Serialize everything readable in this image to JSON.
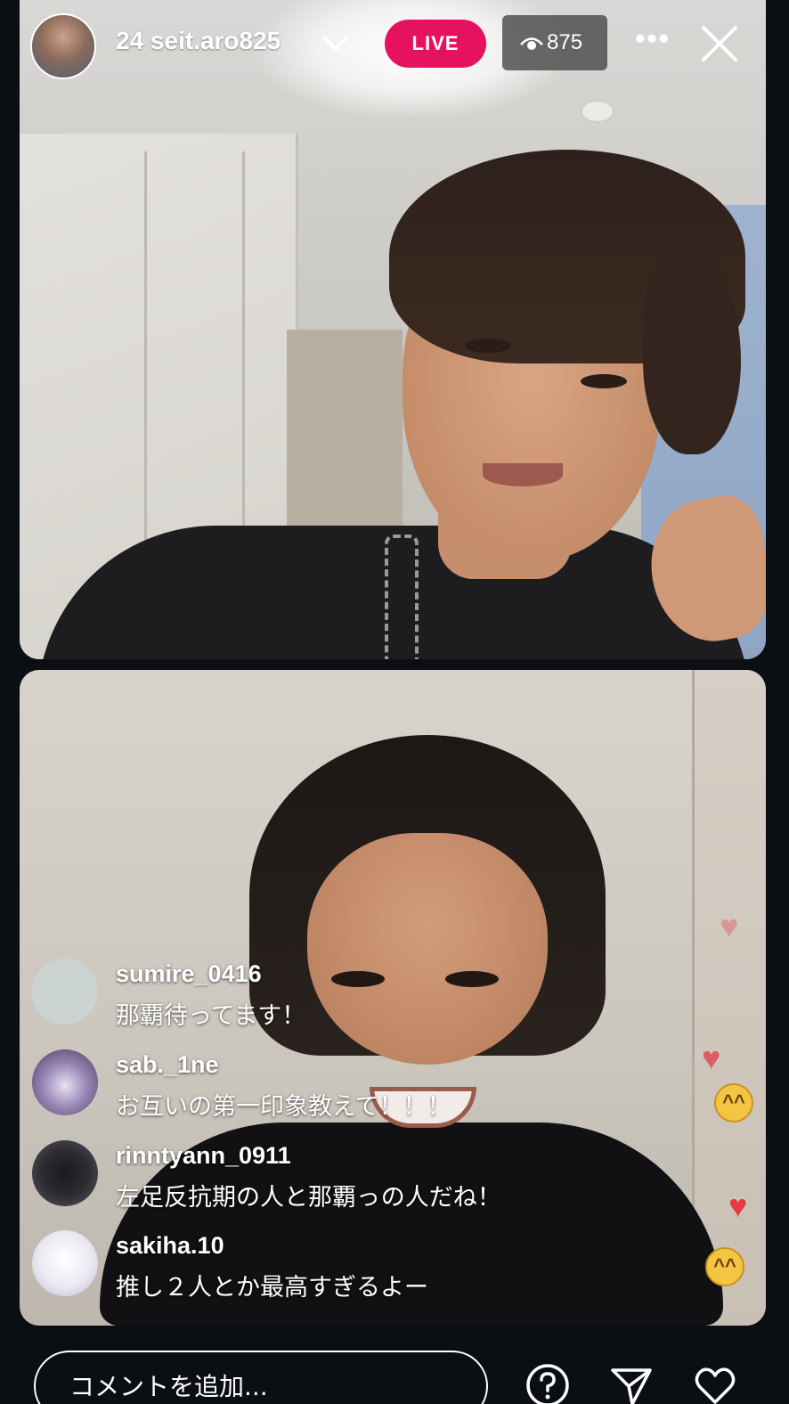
{
  "header": {
    "username": "24  seit.aro825",
    "live_label": "LIVE",
    "viewer_count": "875",
    "more_label": "•••"
  },
  "comments": [
    {
      "user": "sumire_0416",
      "text": "那覇待ってます！",
      "avatar_color": "#cbd3d0"
    },
    {
      "user": "sab._1ne",
      "text": "お互いの第一印象教えて！！！",
      "avatar_color": "#5a4b6d"
    },
    {
      "user": "rinntyann_0911",
      "text": "左足反抗期の人と那覇っの人だね！",
      "avatar_color": "#3a3a3f"
    },
    {
      "user": "sakiha.10",
      "text": "推し２人とか最高すぎるよー",
      "avatar_color": "#e9e6ef"
    }
  ],
  "footer": {
    "comment_placeholder": "コメントを追加..."
  },
  "colors": {
    "live": "#e5135f",
    "background": "#0b0e12",
    "heart": "#e23b46"
  },
  "icons": {
    "viewers": "eye-icon",
    "dropdown": "chevron-down-icon",
    "close": "close-icon",
    "question": "question-icon",
    "send": "send-icon",
    "like": "heart-icon"
  }
}
